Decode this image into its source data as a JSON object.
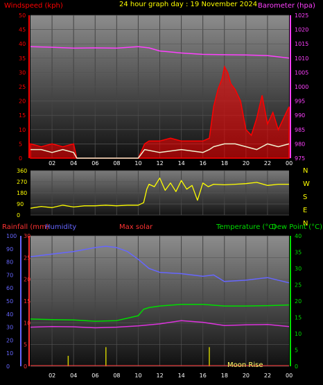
{
  "header": {
    "left_label": "Windspeed (kph)",
    "center_label": "24 hour graph day : 19 November 2024",
    "right_label": "Barometer (hpa)"
  },
  "colors": {
    "windspeed": "#ff0000",
    "barometer": "#ff40ff",
    "wind_dir": "#ffff00",
    "humidity": "#6666ff",
    "temperature": "#00dd00",
    "dewpoint": "#dd33dd",
    "rain": "#ff3333",
    "solar": "#ff3333",
    "moon": "#ffff66",
    "gust": "#f0f0d0"
  },
  "panel_bottom": {
    "rain_label": "Rainfall (mm)",
    "humidity_label": "Humidity",
    "solar_label": "Max solar",
    "temp_label": "Temperature (°C)",
    "dew_label": "Dew Point (°C)",
    "moon_label": "Moon Rise"
  },
  "compass": [
    "N",
    "W",
    "S",
    "E",
    "N"
  ],
  "chart_data": [
    {
      "type": "line",
      "title": "24 hour graph day : 19 November 2024",
      "x_ticks": [
        "02",
        "04",
        "06",
        "08",
        "10",
        "12",
        "14",
        "16",
        "18",
        "20",
        "22",
        "00"
      ],
      "left_axis": {
        "label": "Windspeed (kph)",
        "range": [
          0,
          50
        ],
        "ticks": [
          "0",
          "5",
          "10",
          "15",
          "20",
          "25",
          "30",
          "35",
          "40",
          "45",
          "50"
        ]
      },
      "right_axis": {
        "label": "Barometer (hpa)",
        "range": [
          975,
          1025
        ],
        "ticks": [
          "975",
          "980",
          "985",
          "990",
          "995",
          "1000",
          "1005",
          "1010",
          "1015",
          "1020",
          "1025"
        ]
      },
      "series": [
        {
          "name": "Barometer (hpa)",
          "axis": "right",
          "x": [
            0,
            2,
            4,
            6,
            8,
            10,
            11,
            12,
            14,
            16,
            18,
            20,
            22,
            24
          ],
          "values": [
            1014,
            1013.8,
            1013.5,
            1013.6,
            1013.5,
            1014,
            1013.6,
            1012.5,
            1011.8,
            1011.3,
            1011.2,
            1011.1,
            1010.9,
            1010
          ]
        },
        {
          "name": "Windspeed (kph)",
          "axis": "left",
          "x": [
            0,
            1,
            2,
            3,
            4,
            4.3,
            6,
            8,
            10,
            10.6,
            11,
            12,
            13,
            14,
            15,
            16,
            16.6,
            17,
            17.4,
            17.8,
            18,
            18.3,
            18.6,
            19,
            19.5,
            20,
            20.5,
            21,
            21.5,
            22,
            22.5,
            23,
            23.5,
            24
          ],
          "values": [
            5,
            4,
            5,
            4,
            5,
            0,
            0,
            0,
            0,
            5,
            6,
            6,
            7,
            6,
            6,
            6,
            7,
            18,
            24,
            28,
            32,
            30,
            26,
            24,
            20,
            10,
            8,
            14,
            22,
            12,
            16,
            10,
            14,
            18
          ]
        },
        {
          "name": "Gust",
          "axis": "left",
          "x": [
            0,
            1,
            2,
            3,
            4,
            4.3,
            6,
            8,
            10,
            10.6,
            12,
            14,
            16,
            16.6,
            17,
            18,
            19,
            20,
            21,
            22,
            23,
            24
          ],
          "values": [
            3,
            3,
            2,
            3,
            2,
            0,
            0,
            0,
            0,
            3,
            2,
            3,
            2,
            3,
            4,
            5,
            5,
            4,
            3,
            5,
            4,
            5
          ]
        }
      ]
    },
    {
      "type": "line",
      "x_ticks": [
        "02",
        "04",
        "06",
        "08",
        "10",
        "12",
        "14",
        "16",
        "18",
        "20",
        "22",
        "00"
      ],
      "left_axis": {
        "range": [
          0,
          360
        ],
        "ticks": [
          "0",
          "90",
          "180",
          "270",
          "360"
        ]
      },
      "series": [
        {
          "name": "Wind direction",
          "x": [
            0,
            1,
            2,
            3,
            4,
            5,
            6,
            7,
            8,
            9,
            10,
            10.5,
            10.8,
            11,
            11.5,
            12,
            12.5,
            13,
            13.5,
            14,
            14.5,
            15,
            15.5,
            16,
            16.5,
            17,
            18,
            19,
            20,
            21,
            22,
            23,
            24
          ],
          "values": [
            55,
            70,
            60,
            80,
            65,
            75,
            75,
            80,
            75,
            80,
            80,
            100,
            210,
            250,
            230,
            300,
            200,
            260,
            190,
            280,
            210,
            240,
            120,
            260,
            230,
            250,
            245,
            250,
            255,
            265,
            240,
            250,
            250
          ]
        }
      ]
    },
    {
      "type": "line",
      "x_ticks": [
        "02",
        "04",
        "06",
        "08",
        "10",
        "12",
        "14",
        "16",
        "18",
        "20",
        "22",
        "00"
      ],
      "left_axis_rain": {
        "label": "Rainfall (mm)",
        "range": [
          0,
          30
        ],
        "ticks": [
          "0",
          "5",
          "10",
          "15",
          "20",
          "25",
          "30"
        ]
      },
      "left_axis_humidity": {
        "label": "Humidity",
        "range": [
          0,
          100
        ],
        "ticks": [
          "0",
          "10",
          "20",
          "30",
          "40",
          "50",
          "60",
          "70",
          "80",
          "90",
          "100"
        ]
      },
      "right_axis": {
        "label": "Temperature (°C)",
        "range": [
          0,
          40
        ],
        "ticks": [
          "0",
          "5",
          "10",
          "15",
          "20",
          "25",
          "30",
          "35",
          "40"
        ]
      },
      "series": [
        {
          "name": "Humidity",
          "axis": "humidity",
          "x": [
            0,
            2,
            4,
            6,
            7,
            8,
            9,
            10,
            11,
            12,
            14,
            16,
            17,
            18,
            20,
            22,
            24
          ],
          "values": [
            84,
            86,
            88,
            91,
            92,
            91,
            88,
            82,
            75,
            72,
            71,
            69,
            70,
            65,
            66,
            68,
            64
          ]
        },
        {
          "name": "Temperature (°C)",
          "axis": "right",
          "x": [
            0,
            2,
            4,
            6,
            8,
            10,
            10.5,
            11,
            12,
            14,
            16,
            18,
            20,
            22,
            24
          ],
          "values": [
            14.5,
            14.3,
            14.2,
            13.8,
            14,
            15.5,
            17.5,
            18,
            18.5,
            19,
            19,
            18.5,
            18.5,
            18.6,
            18.8
          ]
        },
        {
          "name": "Dew Point (°C)",
          "axis": "right",
          "x": [
            0,
            2,
            4,
            6,
            8,
            10,
            12,
            14,
            16,
            18,
            20,
            22,
            24
          ],
          "values": [
            12,
            12.2,
            12.1,
            11.8,
            12,
            12.4,
            13,
            14,
            13.5,
            12.5,
            12.7,
            12.8,
            12.2
          ]
        },
        {
          "name": "Rainfall (mm)",
          "axis": "rain",
          "x": [
            3.5,
            7,
            16.6
          ],
          "values": [
            1.2,
            2.2,
            2.2
          ]
        }
      ]
    }
  ]
}
